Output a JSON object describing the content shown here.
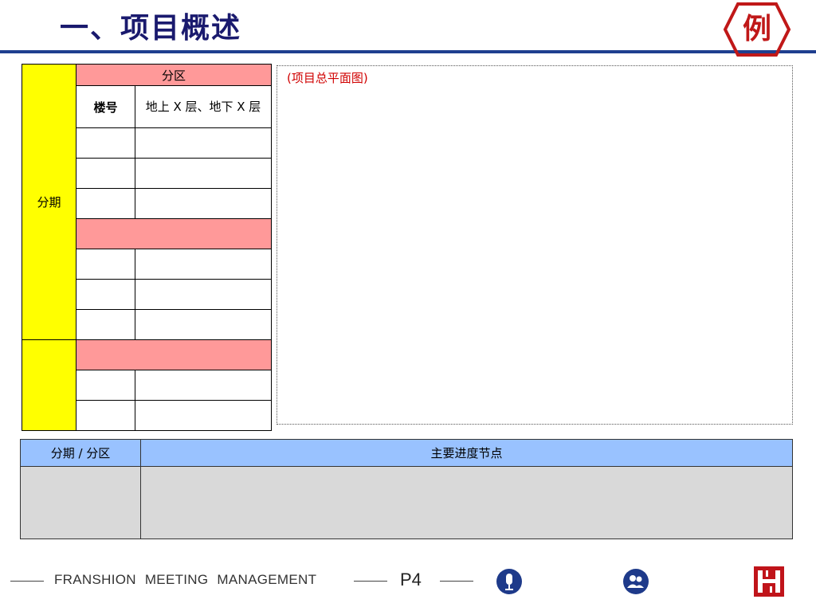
{
  "header": {
    "title": "一、项目概述",
    "badge": "例"
  },
  "left_table": {
    "header_zone": "分区",
    "header_building": "楼号",
    "header_floors": "地上 X 层、地下 X 层",
    "phase_label": "分期"
  },
  "plan": {
    "caption": "(项目总平面图)"
  },
  "schedule": {
    "col1": "分期 / 分区",
    "col2": "主要进度节点"
  },
  "footer": {
    "text": "FRANSHION MEETING MANAGEMENT",
    "page": "P4",
    "icons": [
      "microphone-icon",
      "people-icon",
      "franshion-logo"
    ],
    "colors": {
      "title": "#1a1a6e",
      "rule": "#1f3f8f",
      "phase": "#ffff00",
      "zone": "#ff9999",
      "header": "#99c2ff",
      "badge": "#c01818"
    }
  }
}
